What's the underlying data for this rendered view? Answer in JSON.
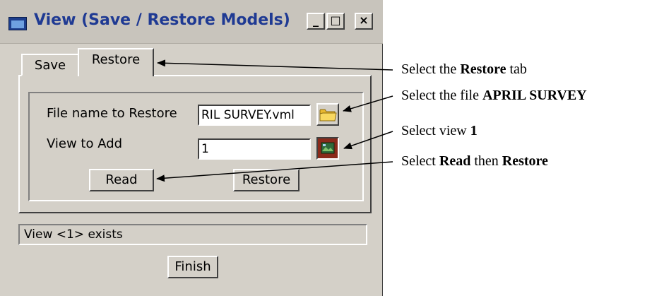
{
  "window": {
    "title": "View (Save / Restore Models)",
    "controls": {
      "minimize": "_",
      "maximize": "□",
      "close": "×"
    }
  },
  "tabs": [
    {
      "label": "Save",
      "active": false
    },
    {
      "label": "Restore",
      "active": true
    }
  ],
  "form": {
    "file_label": "File name to Restore",
    "file_value": "RIL SURVEY.vml",
    "view_label": "View to Add",
    "view_value": "1",
    "file_button_icon": "folder-icon",
    "view_button_icon": "view-picker-icon"
  },
  "buttons": {
    "read": "Read",
    "restore": "Restore",
    "finish": "Finish"
  },
  "status": "View <1> exists",
  "annotations": [
    {
      "pre": "Select the ",
      "bold": "Restore",
      "post": " tab"
    },
    {
      "pre": "Select the file ",
      "bold": "APRIL SURVEY",
      "post": ""
    },
    {
      "pre": "Select view ",
      "bold": "1",
      "post": ""
    },
    {
      "pre": "Select ",
      "bold": "Read",
      "mid": " then ",
      "bold2": "Restore",
      "post": ""
    }
  ],
  "colors": {
    "title_text": "#1f3a93",
    "window_bg": "#d4d0c8",
    "annotation_text": "#000000"
  }
}
